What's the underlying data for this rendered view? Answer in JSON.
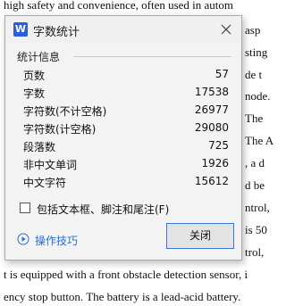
{
  "document": {
    "line_top": "high safety and convenience, often used in autom",
    "right_fragments": [
      "asp",
      "sting",
      "de t",
      "node.",
      "The",
      "The A",
      ", a d",
      "d be",
      "ntrol,",
      "is 50",
      "trol,"
    ],
    "line_bottom_1": "t is equipped with a front obstacle detection sensor, i",
    "line_bottom_2": "ency stop button. The battery is a lead-acid battery."
  },
  "dialog": {
    "app_icon_letter": "W",
    "title": "字数统计",
    "section_label": "统计信息",
    "stats": [
      {
        "label": "页数",
        "value": "57"
      },
      {
        "label": "字数",
        "value": "17538"
      },
      {
        "label": "字符数(不计空格)",
        "value": "26977"
      },
      {
        "label": "字符数(计空格)",
        "value": "29080"
      },
      {
        "label": "段落数",
        "value": "725"
      },
      {
        "label": "非中文单词",
        "value": "1926"
      },
      {
        "label": "中文字符",
        "value": "15612"
      }
    ],
    "checkbox_label": "包括文本框、脚注和尾注(F)",
    "checkbox_checked": false,
    "tips_label": "操作技巧",
    "close_label": "关闭"
  },
  "colors": {
    "accent": "#2b5fd9",
    "link": "#2a6fd6",
    "button_border": "#3a78d8"
  },
  "icons": [
    "close-icon",
    "play-circle-icon",
    "wps-writer-icon"
  ]
}
